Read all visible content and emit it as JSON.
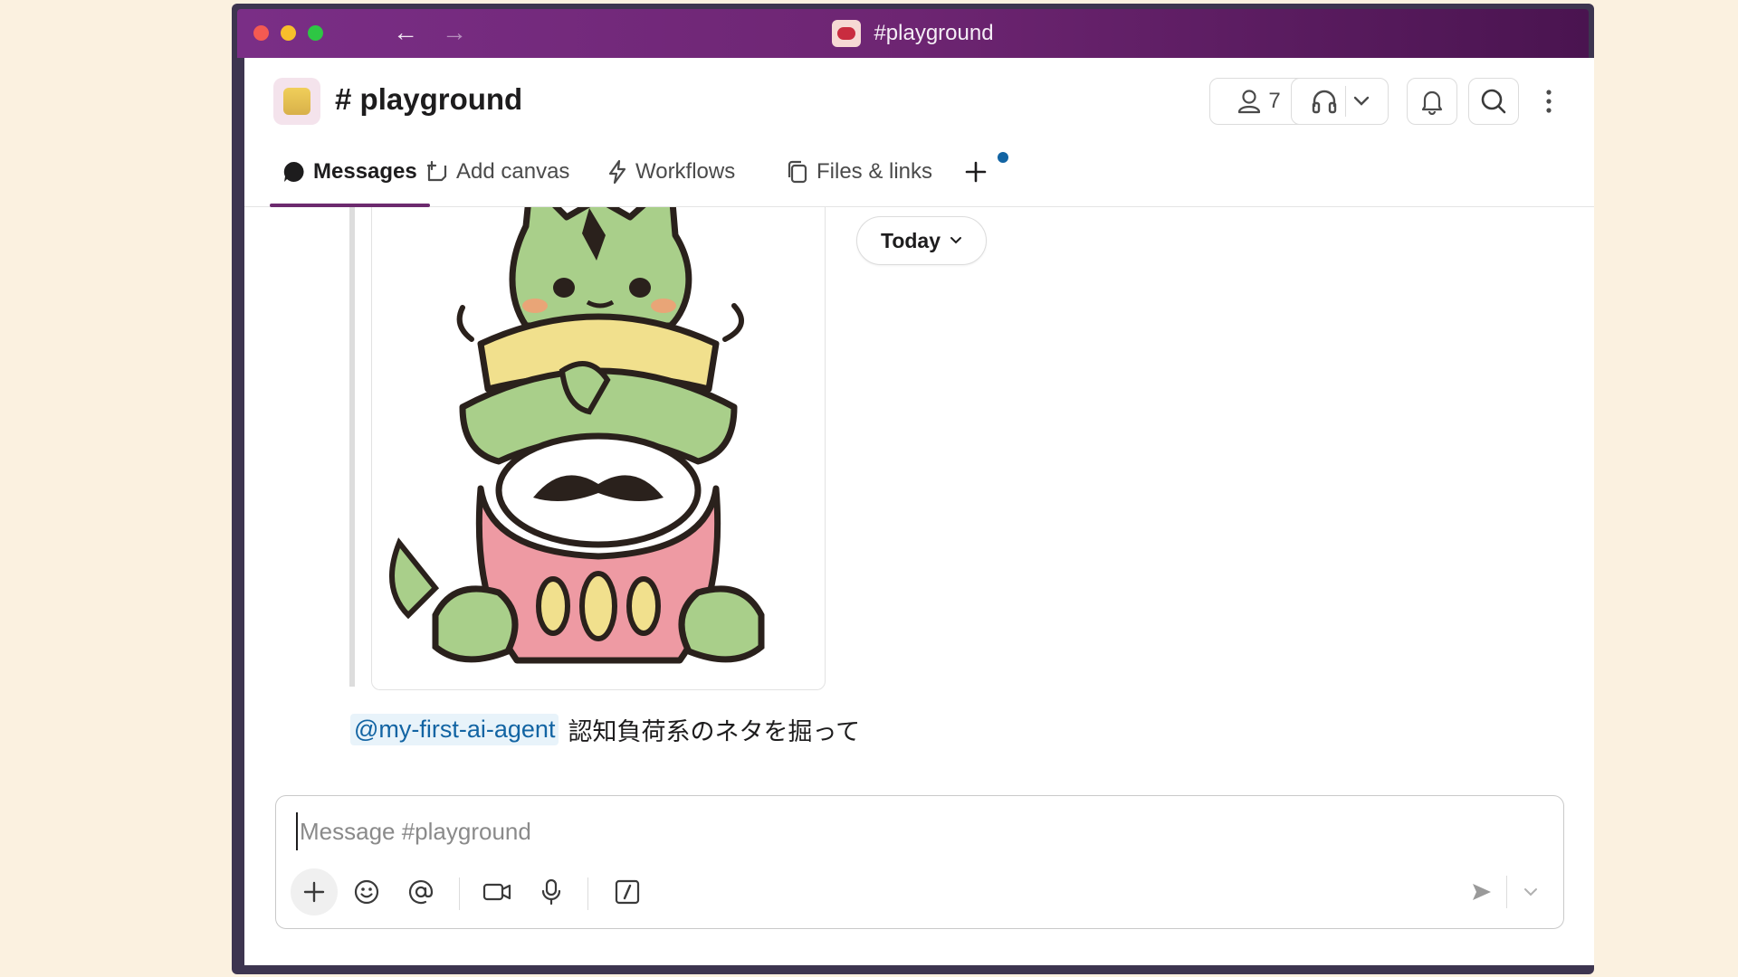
{
  "window": {
    "title": "#playground"
  },
  "channel": {
    "hash": "#",
    "name": "playground",
    "member_count": "7"
  },
  "tabs": [
    {
      "label": "Messages"
    },
    {
      "label": "Add canvas"
    },
    {
      "label": "Workflows"
    },
    {
      "label": "Files & links"
    }
  ],
  "conversation": {
    "date_divider": "Today",
    "message": {
      "mention": "@my-first-ai-agent",
      "text": "認知負荷系のネタを掘って"
    }
  },
  "composer": {
    "placeholder": "Message #playground"
  },
  "colors": {
    "titlebar": "#6d2572",
    "accent_tab": "#6c2a6e",
    "mention_text": "#1264a3",
    "mention_bg": "#e8f3fa",
    "notification_dot": "#1264a3",
    "page_background": "#fbf1e0"
  },
  "icons": [
    "arrow-left-icon",
    "arrow-right-icon",
    "person-icon",
    "headphones-icon",
    "chevron-down-icon",
    "bell-icon",
    "search-icon",
    "more-vertical-icon",
    "message-bubble-icon",
    "canvas-icon",
    "lightning-icon",
    "files-icon",
    "plus-icon",
    "emoji-icon",
    "at-mention-icon",
    "video-icon",
    "microphone-icon",
    "slash-command-icon",
    "send-icon"
  ]
}
